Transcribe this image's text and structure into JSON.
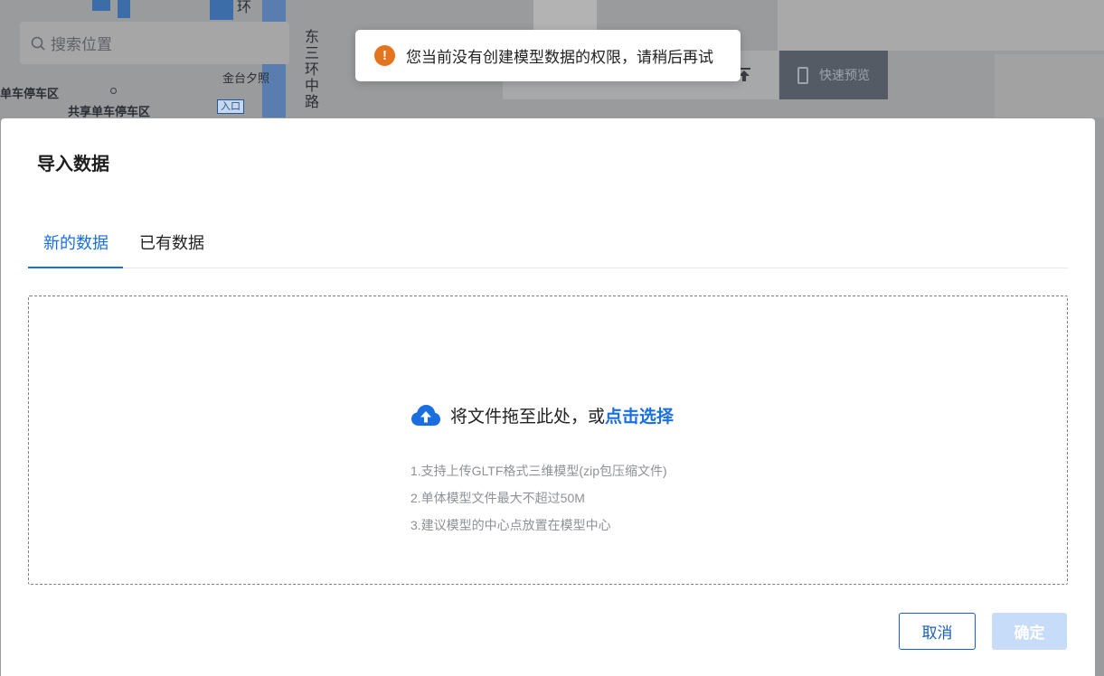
{
  "map": {
    "search_placeholder": "搜索位置",
    "labels": {
      "bike_parking_1": "单车停车区",
      "bike_parking_2": "共享单车停车区",
      "jintai": "金台夕照",
      "ring_top": "环",
      "east_third_ring": "东三环中路",
      "entrance": "入口"
    },
    "quick_preview_label": "快速预览"
  },
  "toast": {
    "icon": "warning-icon",
    "message": "您当前没有创建模型数据的权限，请稍后再试",
    "color": "#e4741d"
  },
  "modal": {
    "title": "导入数据",
    "tabs": [
      {
        "label": "新的数据",
        "active": true
      },
      {
        "label": "已有数据",
        "active": false
      }
    ],
    "dropzone": {
      "icon": "cloud-upload-icon",
      "text": "将文件拖至此处，或",
      "link": "点击选择",
      "tips": [
        "1.支持上传GLTF格式三维模型(zip包压缩文件)",
        "2.单体模型文件最大不超过50M",
        "3.建议模型的中心点放置在模型中心"
      ]
    },
    "buttons": {
      "cancel": "取消",
      "confirm": "确定"
    }
  },
  "colors": {
    "accent": "#1a6fe0",
    "confirm_disabled": "#c6dcf8"
  }
}
